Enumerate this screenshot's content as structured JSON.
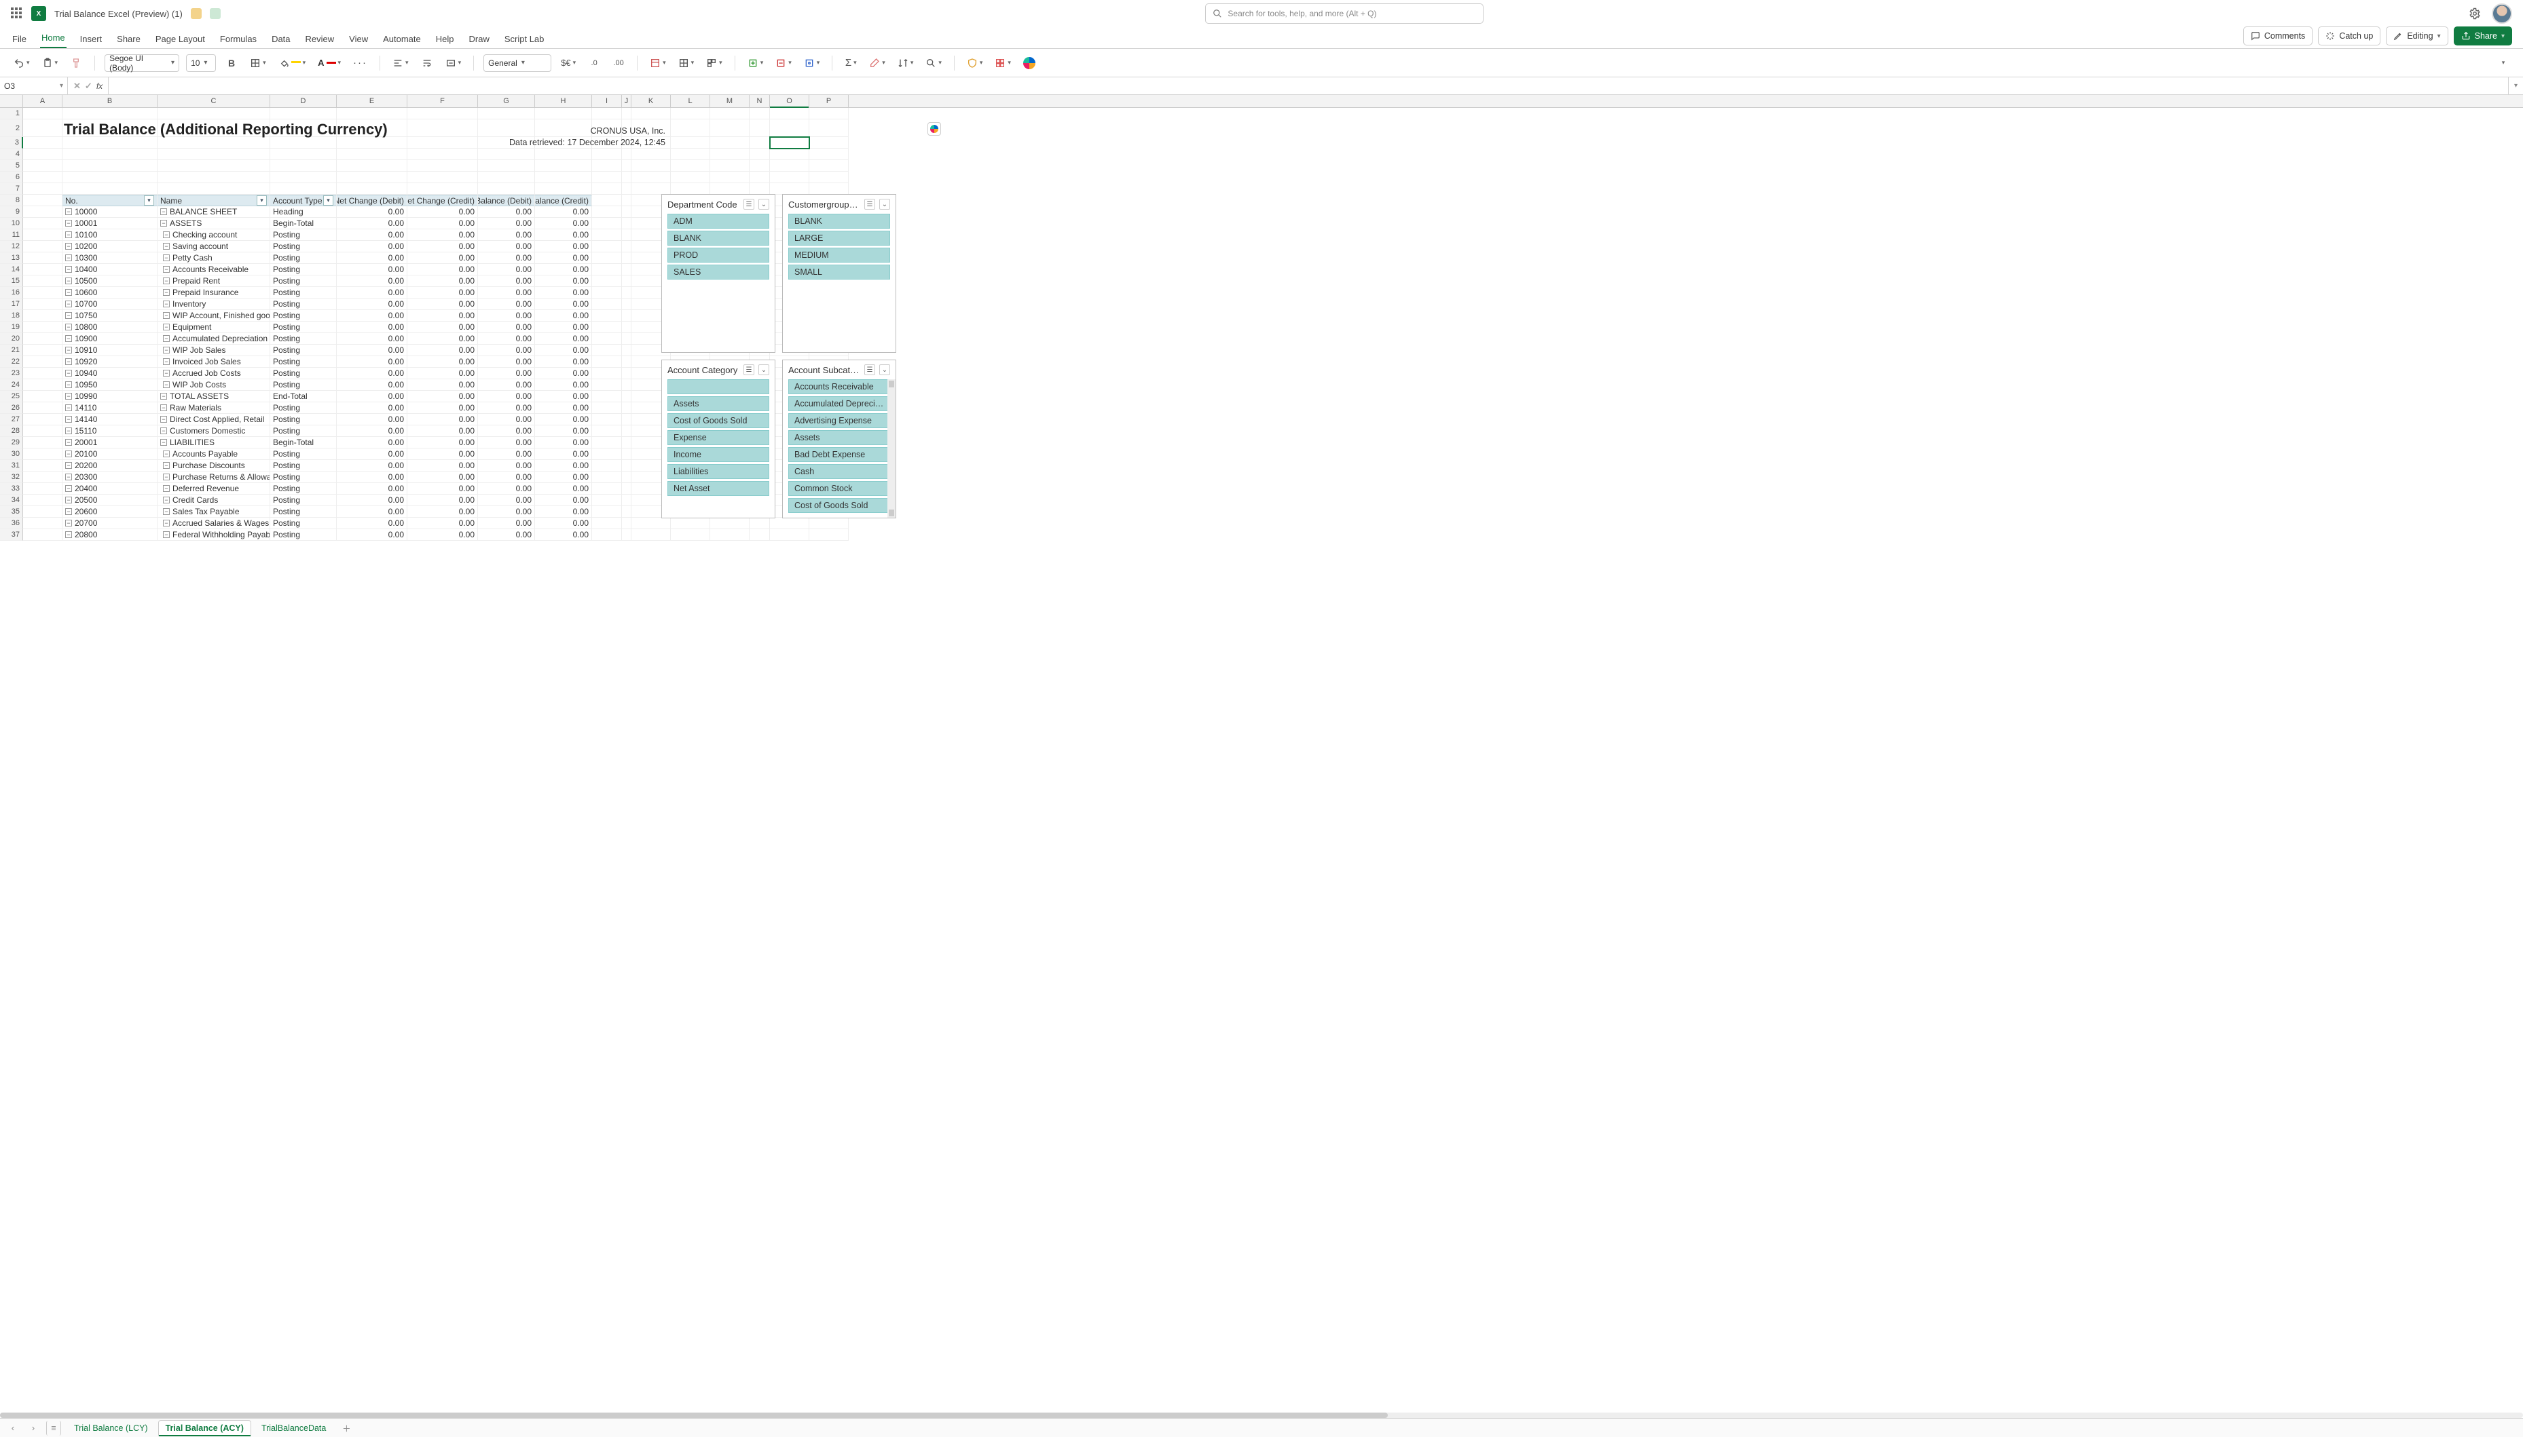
{
  "title": {
    "doc": "Trial Balance Excel (Preview) (1)",
    "search_placeholder": "Search for tools, help, and more (Alt + Q)"
  },
  "menu": {
    "items": [
      "File",
      "Home",
      "Insert",
      "Share",
      "Page Layout",
      "Formulas",
      "Data",
      "Review",
      "View",
      "Automate",
      "Help",
      "Draw",
      "Script Lab"
    ],
    "active": "Home",
    "comments": "Comments",
    "catchup": "Catch up",
    "editing": "Editing",
    "share": "Share"
  },
  "ribbon": {
    "font_name": "Segoe UI (Body)",
    "font_size": "10",
    "number_format": "General"
  },
  "namebox": "O3",
  "columns": [
    "A",
    "B",
    "C",
    "D",
    "E",
    "F",
    "G",
    "H",
    "I",
    "J",
    "K",
    "L",
    "M",
    "N",
    "O",
    "P"
  ],
  "selected_col": "O",
  "selected_row": 3,
  "report": {
    "title": "Trial Balance (Additional Reporting Currency)",
    "company": "CRONUS USA, Inc.",
    "retrieved": "Data retrieved: 17 December 2024, 12:45"
  },
  "table": {
    "headers": {
      "no": "No.",
      "name": "Name",
      "account_type": "Account Type",
      "net_debit": "Net Change (Debit)",
      "net_credit": "Net Change (Credit)",
      "bal_debit": "Balance (Debit)",
      "bal_credit": "Balance (Credit)"
    },
    "rows": [
      {
        "n": "10000",
        "name": "BALANCE SHEET",
        "type": "Heading",
        "v": [
          "0.00",
          "0.00",
          "0.00",
          "0.00"
        ],
        "lvl": 0
      },
      {
        "n": "10001",
        "name": "ASSETS",
        "type": "Begin-Total",
        "v": [
          "0.00",
          "0.00",
          "0.00",
          "0.00"
        ],
        "lvl": 0
      },
      {
        "n": "10100",
        "name": "Checking account",
        "type": "Posting",
        "v": [
          "0.00",
          "0.00",
          "0.00",
          "0.00"
        ],
        "lvl": 1
      },
      {
        "n": "10200",
        "name": "Saving account",
        "type": "Posting",
        "v": [
          "0.00",
          "0.00",
          "0.00",
          "0.00"
        ],
        "lvl": 1
      },
      {
        "n": "10300",
        "name": "Petty Cash",
        "type": "Posting",
        "v": [
          "0.00",
          "0.00",
          "0.00",
          "0.00"
        ],
        "lvl": 1
      },
      {
        "n": "10400",
        "name": "Accounts Receivable",
        "type": "Posting",
        "v": [
          "0.00",
          "0.00",
          "0.00",
          "0.00"
        ],
        "lvl": 1
      },
      {
        "n": "10500",
        "name": "Prepaid Rent",
        "type": "Posting",
        "v": [
          "0.00",
          "0.00",
          "0.00",
          "0.00"
        ],
        "lvl": 1
      },
      {
        "n": "10600",
        "name": "Prepaid Insurance",
        "type": "Posting",
        "v": [
          "0.00",
          "0.00",
          "0.00",
          "0.00"
        ],
        "lvl": 1
      },
      {
        "n": "10700",
        "name": "Inventory",
        "type": "Posting",
        "v": [
          "0.00",
          "0.00",
          "0.00",
          "0.00"
        ],
        "lvl": 1
      },
      {
        "n": "10750",
        "name": "WIP Account, Finished good",
        "type": "Posting",
        "v": [
          "0.00",
          "0.00",
          "0.00",
          "0.00"
        ],
        "lvl": 1
      },
      {
        "n": "10800",
        "name": "Equipment",
        "type": "Posting",
        "v": [
          "0.00",
          "0.00",
          "0.00",
          "0.00"
        ],
        "lvl": 1
      },
      {
        "n": "10900",
        "name": "Accumulated Depreciation",
        "type": "Posting",
        "v": [
          "0.00",
          "0.00",
          "0.00",
          "0.00"
        ],
        "lvl": 1
      },
      {
        "n": "10910",
        "name": "WIP Job Sales",
        "type": "Posting",
        "v": [
          "0.00",
          "0.00",
          "0.00",
          "0.00"
        ],
        "lvl": 1
      },
      {
        "n": "10920",
        "name": "Invoiced Job Sales",
        "type": "Posting",
        "v": [
          "0.00",
          "0.00",
          "0.00",
          "0.00"
        ],
        "lvl": 1
      },
      {
        "n": "10940",
        "name": "Accrued Job Costs",
        "type": "Posting",
        "v": [
          "0.00",
          "0.00",
          "0.00",
          "0.00"
        ],
        "lvl": 1
      },
      {
        "n": "10950",
        "name": "WIP Job Costs",
        "type": "Posting",
        "v": [
          "0.00",
          "0.00",
          "0.00",
          "0.00"
        ],
        "lvl": 1
      },
      {
        "n": "10990",
        "name": "TOTAL ASSETS",
        "type": "End-Total",
        "v": [
          "0.00",
          "0.00",
          "0.00",
          "0.00"
        ],
        "lvl": 0
      },
      {
        "n": "14110",
        "name": "Raw Materials",
        "type": "Posting",
        "v": [
          "0.00",
          "0.00",
          "0.00",
          "0.00"
        ],
        "lvl": 0
      },
      {
        "n": "14140",
        "name": "Direct Cost Applied, Retail",
        "type": "Posting",
        "v": [
          "0.00",
          "0.00",
          "0.00",
          "0.00"
        ],
        "lvl": 0
      },
      {
        "n": "15110",
        "name": "Customers Domestic",
        "type": "Posting",
        "v": [
          "0.00",
          "0.00",
          "0.00",
          "0.00"
        ],
        "lvl": 0
      },
      {
        "n": "20001",
        "name": "LIABILITIES",
        "type": "Begin-Total",
        "v": [
          "0.00",
          "0.00",
          "0.00",
          "0.00"
        ],
        "lvl": 0
      },
      {
        "n": "20100",
        "name": "Accounts Payable",
        "type": "Posting",
        "v": [
          "0.00",
          "0.00",
          "0.00",
          "0.00"
        ],
        "lvl": 1
      },
      {
        "n": "20200",
        "name": "Purchase Discounts",
        "type": "Posting",
        "v": [
          "0.00",
          "0.00",
          "0.00",
          "0.00"
        ],
        "lvl": 1
      },
      {
        "n": "20300",
        "name": "Purchase Returns & Allowan",
        "type": "Posting",
        "v": [
          "0.00",
          "0.00",
          "0.00",
          "0.00"
        ],
        "lvl": 1
      },
      {
        "n": "20400",
        "name": "Deferred Revenue",
        "type": "Posting",
        "v": [
          "0.00",
          "0.00",
          "0.00",
          "0.00"
        ],
        "lvl": 1
      },
      {
        "n": "20500",
        "name": "Credit Cards",
        "type": "Posting",
        "v": [
          "0.00",
          "0.00",
          "0.00",
          "0.00"
        ],
        "lvl": 1
      },
      {
        "n": "20600",
        "name": "Sales Tax Payable",
        "type": "Posting",
        "v": [
          "0.00",
          "0.00",
          "0.00",
          "0.00"
        ],
        "lvl": 1
      },
      {
        "n": "20700",
        "name": "Accrued Salaries & Wages",
        "type": "Posting",
        "v": [
          "0.00",
          "0.00",
          "0.00",
          "0.00"
        ],
        "lvl": 1
      },
      {
        "n": "20800",
        "name": "Federal Withholding Payabl",
        "type": "Posting",
        "v": [
          "0.00",
          "0.00",
          "0.00",
          "0.00"
        ],
        "lvl": 1
      }
    ]
  },
  "slicers": {
    "dept": {
      "title": "Department Code",
      "items": [
        "ADM",
        "BLANK",
        "PROD",
        "SALES"
      ]
    },
    "cust": {
      "title": "Customergroup…",
      "items": [
        "BLANK",
        "LARGE",
        "MEDIUM",
        "SMALL"
      ]
    },
    "acccat": {
      "title": "Account Category",
      "items": [
        "",
        "Assets",
        "Cost of Goods Sold",
        "Expense",
        "Income",
        "Liabilities",
        "Net Asset"
      ]
    },
    "accsub": {
      "title": "Account Subcat…",
      "items": [
        "Accounts Receivable",
        "Accumulated Depreci…",
        "Advertising Expense",
        "Assets",
        "Bad Debt Expense",
        "Cash",
        "Common Stock",
        "Cost of Goods Sold"
      ],
      "scroll": true
    }
  },
  "sheets": {
    "tabs": [
      "Trial Balance (LCY)",
      "Trial Balance (ACY)",
      "TrialBalanceData"
    ],
    "active": "Trial Balance (ACY)"
  }
}
